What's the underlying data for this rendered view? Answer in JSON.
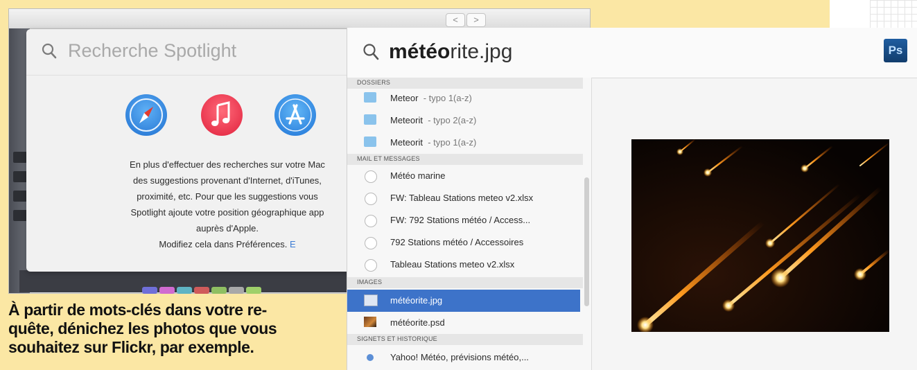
{
  "background_window": {
    "nav_back": "<",
    "nav_forward": ">"
  },
  "spotlight_home": {
    "search_placeholder": "Recherche Spotlight",
    "app_icons": [
      "safari-icon",
      "itunes-icon",
      "app-store-icon"
    ],
    "description_lines": [
      "En plus d'effectuer des recherches sur votre Mac",
      "des suggestions provenant d'Internet, d'iTunes,",
      "proximité, etc. Pour que les suggestions vous",
      "Spotlight ajoute votre position géographique app",
      "auprès d'Apple."
    ],
    "modify_line": "Modifiez cela dans Préférences.",
    "more_link": "E"
  },
  "spotlight_results": {
    "query_typed": "météo",
    "query_completion": "rite.jpg",
    "app_badge": "Ps",
    "sections": [
      {
        "header": "DOSSIERS",
        "items": [
          {
            "label": "Meteor",
            "sub": "- typo 1(a-z)",
            "icon": "folder-icon"
          },
          {
            "label": "Meteorit",
            "sub": "- typo 2(a-z)",
            "icon": "folder-icon"
          },
          {
            "label": "Meteorit",
            "sub": "- typo 1(a-z)",
            "icon": "folder-icon"
          }
        ]
      },
      {
        "header": "MAIL ET MESSAGES",
        "items": [
          {
            "label": "Météo marine",
            "icon": "mail-icon"
          },
          {
            "label": "FW: Tableau Stations meteo v2.xlsx",
            "icon": "mail-icon"
          },
          {
            "label": "FW: 792 Stations météo / Access...",
            "icon": "mail-icon"
          },
          {
            "label": "792 Stations météo / Accessoires",
            "icon": "mail-icon"
          },
          {
            "label": "Tableau Stations meteo v2.xlsx",
            "icon": "mail-icon"
          }
        ]
      },
      {
        "header": "IMAGES",
        "items": [
          {
            "label": "météorite.jpg",
            "icon": "image-file-icon",
            "selected": true
          },
          {
            "label": "météorite.psd",
            "icon": "psd-file-icon"
          }
        ]
      },
      {
        "header": "SIGNETS ET HISTORIQUE",
        "items": [
          {
            "label": "Yahoo! Météo, prévisions météo,...",
            "icon": "web-bookmark-icon"
          }
        ]
      }
    ],
    "selection_color": "#3d73c9"
  },
  "caption": {
    "line1": "À partir de mots-clés dans votre re-",
    "line2": "quête, dénichez les photos que vous",
    "line3": "souhaitez sur Flickr, par exemple."
  }
}
